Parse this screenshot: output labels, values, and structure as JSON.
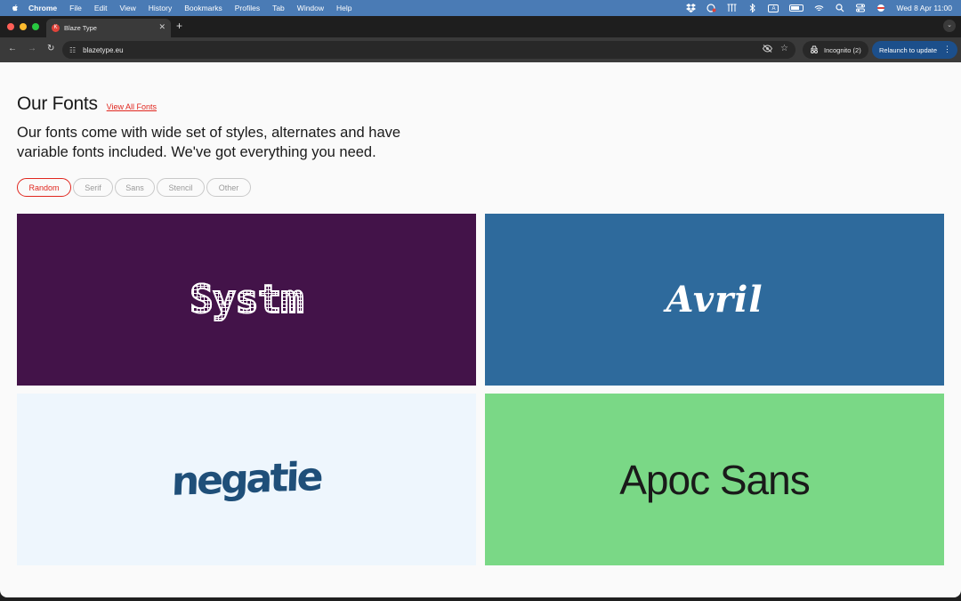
{
  "menubar": {
    "app": "Chrome",
    "items": [
      "File",
      "Edit",
      "View",
      "History",
      "Bookmarks",
      "Profiles",
      "Tab",
      "Window",
      "Help"
    ],
    "input_indicator": "A",
    "datetime": "Wed 8 Apr  11:00"
  },
  "browser": {
    "tab_title": "Blaze Type",
    "tab_favicon": "K",
    "url": "blazetype.eu",
    "incognito_label": "Incognito (2)",
    "relaunch_label": "Relaunch to update"
  },
  "page": {
    "heading": "Our Fonts",
    "view_all": "View All Fonts",
    "intro": "Our fonts come with wide set of styles, alternates and have variable fonts included. We've got everything you need.",
    "filters": [
      "Random",
      "Serif",
      "Sans",
      "Stencil",
      "Other"
    ],
    "active_filter": "Random",
    "accent_color": "#e0271f",
    "fonts": [
      {
        "name": "Systm",
        "bg": "#431349"
      },
      {
        "name": "Avril",
        "bg": "#2e6a9c"
      },
      {
        "name": "negatie",
        "bg": "#eef6fd"
      },
      {
        "name": "Apoc Sans",
        "bg": "#7ad886"
      }
    ]
  }
}
